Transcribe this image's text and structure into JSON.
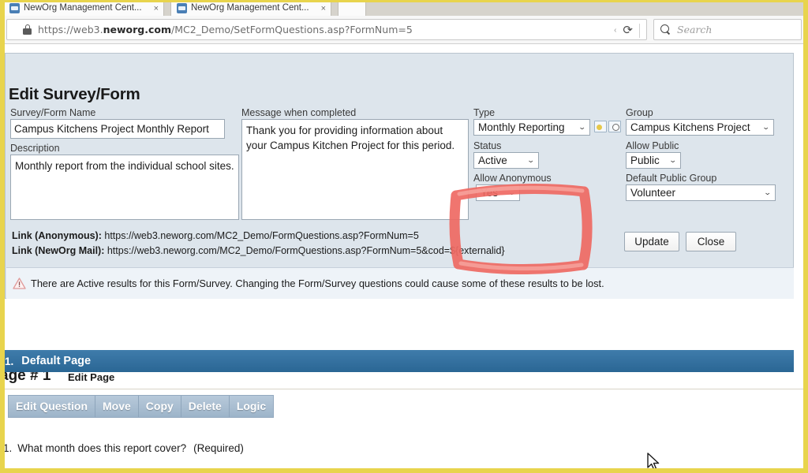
{
  "browser": {
    "tabs": [
      {
        "title": "NewOrg Management Cent...",
        "close": "×"
      },
      {
        "title": "NewOrg Management Cent...",
        "close": "×"
      },
      {
        "title": "",
        "close": ""
      }
    ],
    "url_prefix": "https://web3.",
    "url_domain": "neworg.com",
    "url_suffix": "/MC2_Demo/SetFormQuestions.asp?FormNum=5",
    "reload_glyph": "⟳",
    "caret_glyph": "‹",
    "search_placeholder": "Search",
    "lock_icon": "lock-icon",
    "search_icon": "search-icon"
  },
  "form": {
    "title": "Edit Survey/Form",
    "name_label": "Survey/Form Name",
    "name_value": "Campus Kitchens Project Monthly Report",
    "description_label": "Description",
    "description_value": "Monthly report from the individual school sites.",
    "message_label": "Message when completed",
    "message_value": "Thank you for providing information about your Campus Kitchen Project for this period.",
    "type_label": "Type",
    "type_value": "Monthly Reporting",
    "status_label": "Status",
    "status_value": "Active",
    "allow_anonymous_label": "Allow Anonymous",
    "allow_anonymous_value": "Yes",
    "group_label": "Group",
    "group_value": "Campus Kitchens Project",
    "allow_public_label": "Allow Public",
    "allow_public_value": "Public",
    "default_public_group_label": "Default Public Group",
    "default_public_group_value": "Volunteer",
    "dropdown_arrow": "⌄",
    "link_anonymous_label": "Link (Anonymous):",
    "link_anonymous_url": "https://web3.neworg.com/MC2_Demo/FormQuestions.asp?FormNum=5",
    "link_mail_label": "Link (NewOrg Mail):",
    "link_mail_url": "https://web3.neworg.com/MC2_Demo/FormQuestions.asp?FormNum=5&cod=${externalid}",
    "update_button": "Update",
    "close_button": "Close",
    "warning_text": "There are Active results for this Form/Survey. Changing the Form/Survey questions could cause some of these results to be lost.",
    "warning_icon": "warning-triangle-icon"
  },
  "pages": {
    "heading": "age # 1",
    "edit_page_link": "Edit Page",
    "page_number": "1.",
    "page_name": "Default Page"
  },
  "toolbar": {
    "buttons": [
      "Edit Question",
      "Move",
      "Copy",
      "Delete",
      "Logic"
    ]
  },
  "question": {
    "number": "1.",
    "text": "What month does this report cover?",
    "required": "(Required)"
  },
  "annotation": {
    "shape": "hand-drawn-red-rectangle",
    "color": "#ef6a63"
  },
  "colors": {
    "frame": "#e8d44d",
    "panel_bg": "#dde5ec",
    "page_bar": "#2f6c9c",
    "toolbar_btn": "#a8bcd0"
  }
}
